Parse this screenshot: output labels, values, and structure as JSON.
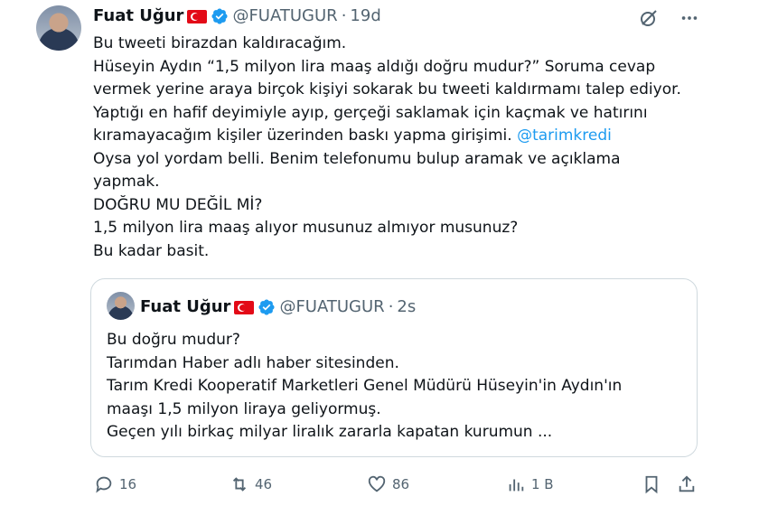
{
  "tweet": {
    "author_name": "Fuat Uğur",
    "handle": "@FUATUGUR",
    "separator": "·",
    "time": "19d",
    "lines": [
      "Bu tweeti birazdan kaldıracağım.",
      "Hüseyin Aydın “1,5 milyon lira maaş aldığı doğru mudur?”  Soruma cevap",
      "vermek yerine araya birçok kişiyi sokarak bu tweeti kaldırmamı talep ediyor.",
      "Yaptığı en hafif deyimiyle ayıp, gerçeği saklamak için kaçmak ve hatırını",
      "Oysa yol yordam belli. Benim telefonumu bulup aramak ve açıklama",
      "yapmak.",
      "DOĞRU MU DEĞİL Mİ?",
      "1,5 milyon lira maaş alıyor musunuz almıyor musunuz?",
      "Bu kadar basit."
    ],
    "line5_text": "kıramayacağım kişiler üzerinden baskı yapma girişimi. ",
    "mention": "@tarimkredi"
  },
  "quoted_tweet": {
    "author_name": "Fuat Uğur",
    "handle": "@FUATUGUR",
    "separator": "·",
    "time": "2s",
    "lines": [
      "Bu doğru mudur?",
      "Tarımdan Haber adlı haber sitesinden.",
      "Tarım Kredi Kooperatif Marketleri Genel Müdürü Hüseyin'in Aydın'ın",
      "maaşı 1,5 milyon liraya geliyormuş.",
      "Geçen yılı birkaç milyar liralık zararla kapatan kurumun ..."
    ]
  },
  "actions": {
    "replies": "16",
    "retweets": "46",
    "likes": "86",
    "views": "1 B"
  },
  "icons": {
    "top": [
      "grok-icon",
      "more-icon"
    ],
    "actions": [
      "reply-icon",
      "retweet-icon",
      "like-icon",
      "views-icon",
      "bookmark-icon",
      "share-icon"
    ]
  },
  "colors": {
    "accent": "#1d9bf0",
    "text": "#0f1419",
    "muted": "#536471",
    "flag": "#e30a17"
  }
}
